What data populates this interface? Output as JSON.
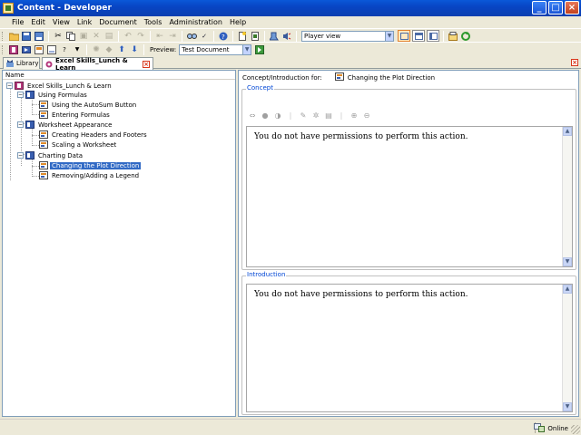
{
  "window": {
    "title": "Content - Developer",
    "controls": [
      "minimize",
      "maximize",
      "close"
    ]
  },
  "menu": [
    "File",
    "Edit",
    "View",
    "Link",
    "Document",
    "Tools",
    "Administration",
    "Help"
  ],
  "toolbar": {
    "view_select": "Player view",
    "preview_label": "Preview:",
    "preview_select": "Test Document"
  },
  "tabs": [
    {
      "label": "Library",
      "active": false
    },
    {
      "label": "Excel Skills_Lunch & Learn",
      "active": true
    }
  ],
  "tree": {
    "header": "Name",
    "nodes": [
      {
        "label": "Excel Skills_Lunch & Learn",
        "type": "book",
        "level": 0
      },
      {
        "label": "Using Formulas",
        "type": "section",
        "level": 1
      },
      {
        "label": "Using the AutoSum Button",
        "type": "topic",
        "level": 2
      },
      {
        "label": "Entering Formulas",
        "type": "topic",
        "level": 2
      },
      {
        "label": "Worksheet Appearance",
        "type": "section",
        "level": 1
      },
      {
        "label": "Creating Headers and Footers",
        "type": "topic",
        "level": 2
      },
      {
        "label": "Scaling a Worksheet",
        "type": "topic",
        "level": 2
      },
      {
        "label": "Charting Data",
        "type": "section",
        "level": 1
      },
      {
        "label": "Changing the Plot Direction",
        "type": "topic",
        "level": 2,
        "selected": true
      },
      {
        "label": "Removing/Adding a Legend",
        "type": "topic",
        "level": 2
      }
    ]
  },
  "detail": {
    "concept_for_label": "Concept/Introduction for:",
    "concept_for_value": "Changing the Plot Direction",
    "concept": {
      "label": "Concept",
      "message": "You do not have permissions to perform this action."
    },
    "introduction": {
      "label": "Introduction",
      "message": "You do not have permissions to perform this action."
    }
  },
  "status": {
    "online": "Online"
  },
  "colors": {
    "titlebar": "#0845c4",
    "selection": "#316ac5",
    "group_label": "#0046d5",
    "close_accent": "#d9361b"
  }
}
